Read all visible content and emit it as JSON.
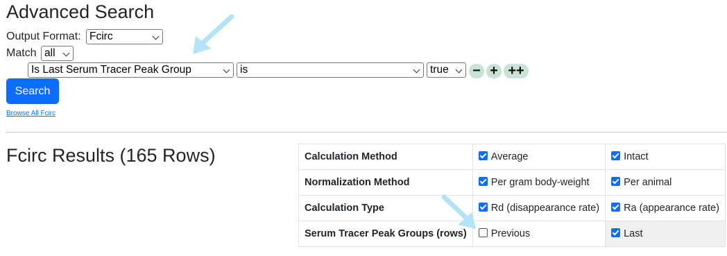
{
  "search": {
    "title": "Advanced Search",
    "output_format_label": "Output Format:",
    "output_format_value": "Fcirc",
    "match_label": "Match",
    "match_value": "all",
    "field_value": "Is Last Serum Tracer Peak Group",
    "operator_value": "is",
    "term_value": "true",
    "remove_label": "−",
    "add_label": "+",
    "add_group_label": "++",
    "search_button": "Search",
    "browse_link": "Browse All Fcirc"
  },
  "results": {
    "title": "Fcirc Results (165 Rows)"
  },
  "options_table": {
    "rows": [
      {
        "header": "Calculation Method",
        "opt1": {
          "label": "Average",
          "checked": true
        },
        "opt2": {
          "label": "Intact",
          "checked": true
        }
      },
      {
        "header": "Normalization Method",
        "opt1": {
          "label": "Per gram body-weight",
          "checked": true
        },
        "opt2": {
          "label": "Per animal",
          "checked": true
        }
      },
      {
        "header": "Calculation Type",
        "opt1": {
          "label": "Rd (disappearance rate)",
          "checked": true
        },
        "opt2": {
          "label": "Ra (appearance rate)",
          "checked": true
        }
      },
      {
        "header": "Serum Tracer Peak Groups (rows)",
        "opt1": {
          "label": "Previous",
          "checked": false
        },
        "opt2": {
          "label": "Last",
          "checked": true
        }
      }
    ]
  },
  "colors": {
    "primary": "#0d6efd",
    "round_button": "#c9e3d6",
    "annotation_arrow": "#b3e3f7"
  },
  "annotations": {
    "arrow_icon": "pointer-arrow-icon"
  }
}
